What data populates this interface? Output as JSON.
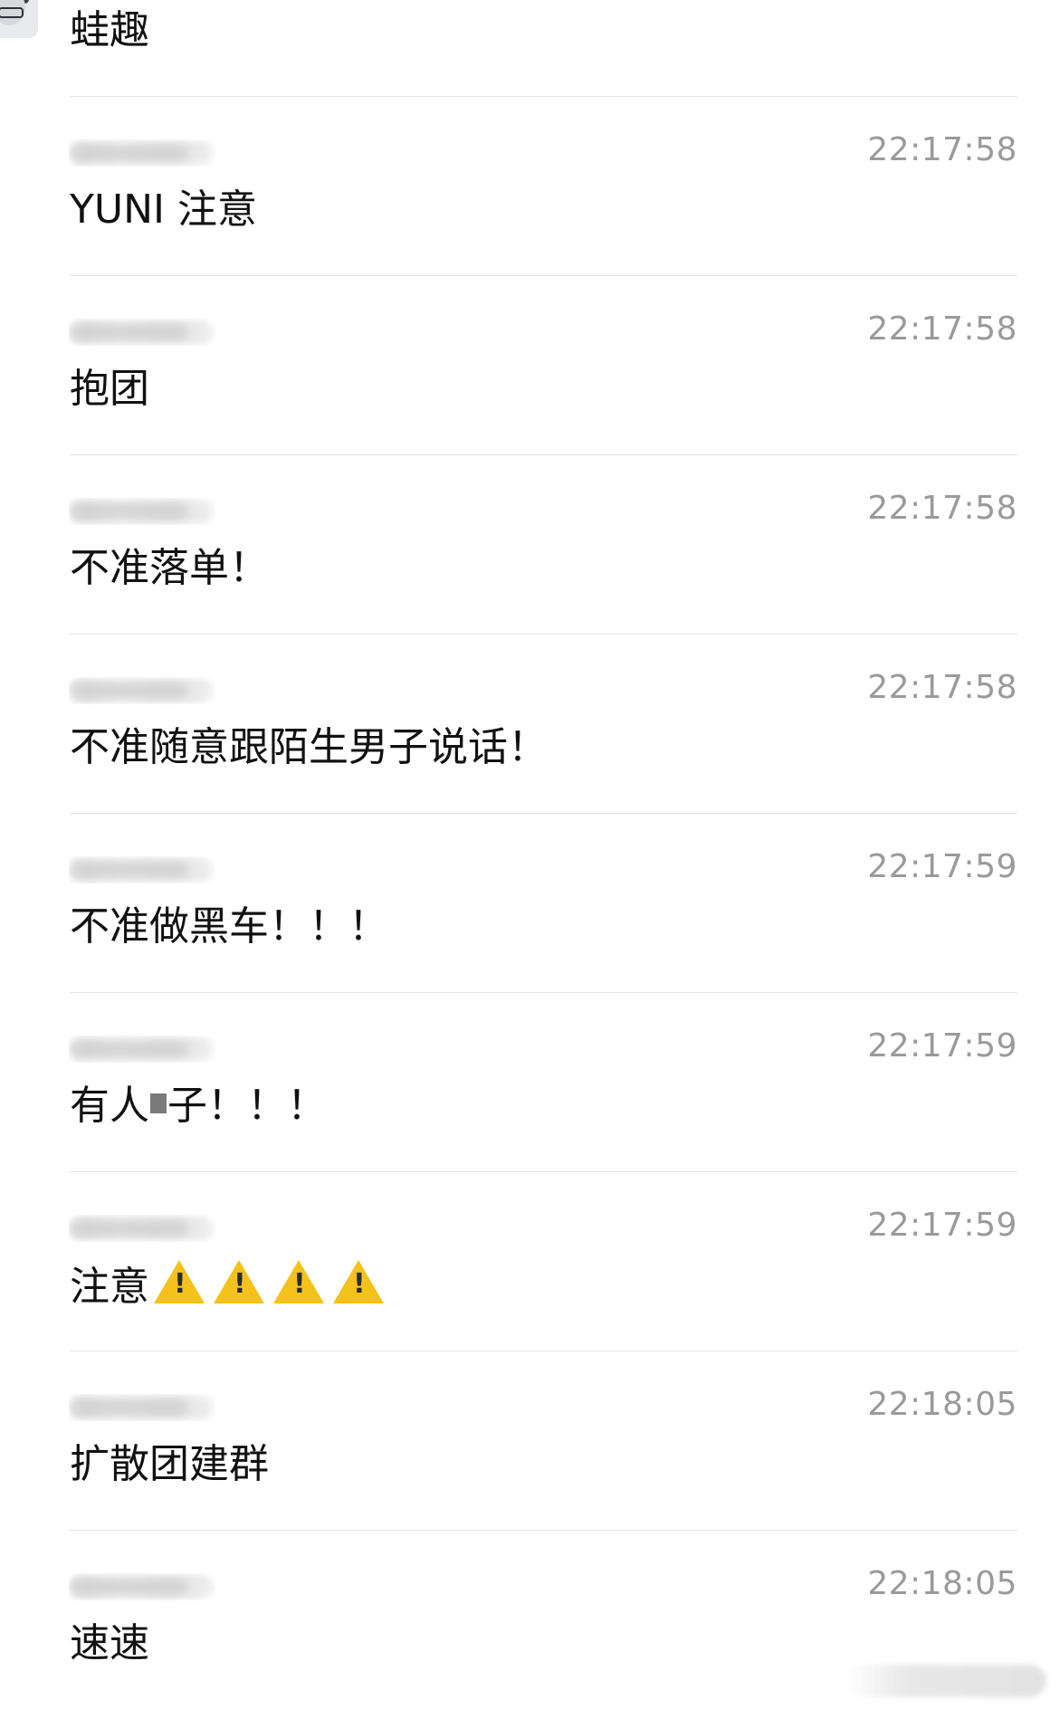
{
  "first_message": {
    "text": "蛙趣"
  },
  "messages": [
    {
      "time": "22:17:58",
      "text": "YUNI 注意"
    },
    {
      "time": "22:17:58",
      "text": "抱团"
    },
    {
      "time": "22:17:58",
      "text": "不准落单！"
    },
    {
      "time": "22:17:58",
      "text": "不准随意跟陌生男子说话！"
    },
    {
      "time": "22:17:59",
      "text": "不准做黑车！！！"
    },
    {
      "time": "22:17:59",
      "text_before": "有人",
      "text_after": "子！！！"
    },
    {
      "time": "22:17:59",
      "text": "注意",
      "warning_icons": 4
    },
    {
      "time": "22:18:05",
      "text": "扩散团建群"
    },
    {
      "time": "22:18:05",
      "text": "速速"
    }
  ],
  "colors": {
    "background": "#ffffff",
    "text": "#111111",
    "timestamp": "#9a9a9a",
    "divider": "#e3e3e3",
    "warning": "#f4c21b"
  },
  "icons": {
    "avatar": "avatar-icon",
    "warning": "warning-icon"
  }
}
